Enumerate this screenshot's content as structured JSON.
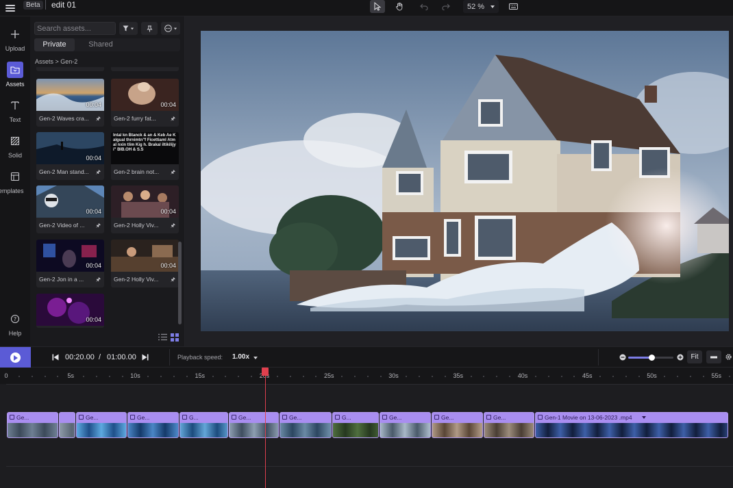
{
  "header": {
    "beta": "Beta",
    "title": "edit 01",
    "zoom": "52 %",
    "tools": [
      "pointer-icon",
      "hand-icon",
      "undo-icon",
      "redo-icon",
      "keyboard-icon"
    ]
  },
  "rail": {
    "items": [
      {
        "label": "Upload",
        "icon": "plus-icon"
      },
      {
        "label": "Assets",
        "icon": "folder-icon"
      },
      {
        "label": "Text",
        "icon": "text-icon"
      },
      {
        "label": "Solid",
        "icon": "solid-icon"
      },
      {
        "label": "Templates",
        "icon": "templates-icon"
      }
    ],
    "help": "Help"
  },
  "assets": {
    "search_placeholder": "Search assets...",
    "tabs": [
      "Private",
      "Shared"
    ],
    "breadcrumb": "Assets > Gen-2",
    "cards": [
      {
        "label": "Gen-2 Waves cra...",
        "duration": "00:04"
      },
      {
        "label": "Gen-2 furry fat...",
        "duration": "00:04"
      },
      {
        "label": "Gen-2 Man stand...",
        "duration": "00:04"
      },
      {
        "label": "Gen-2 brain not...",
        "duration": ""
      },
      {
        "label": "Gen-2 Video of ...",
        "duration": "00:04"
      },
      {
        "label": "Gen-2 Holly Viv...",
        "duration": "00:04"
      },
      {
        "label": "Gen-2 Jon in a ...",
        "duration": "00:04"
      },
      {
        "label": "Gen-2 Holly Viv...",
        "duration": "00:04"
      },
      {
        "label": "",
        "duration": "00:04"
      }
    ],
    "thumb_text": "Intal kn Btanck & an &  Keb Ae Kalgual thrnimtn\"f Ficettiaml Atmal nxin tlim Kig h. Brakal iltikilijy i\" BIB.OH & S.S"
  },
  "transport": {
    "current": "00:20.00",
    "sep": "/",
    "total": "01:00.00",
    "speed_label": "Playback speed:",
    "speed_value": "1.00x",
    "fit": "Fit"
  },
  "ruler": {
    "labels": [
      "0",
      "5s",
      "10s",
      "15s",
      "20s",
      "25s",
      "30s",
      "35s",
      "40s",
      "45s",
      "50s",
      "55s"
    ]
  },
  "timeline": {
    "clips": [
      {
        "label": "Ge..."
      },
      {
        "label": ""
      },
      {
        "label": "Ge..."
      },
      {
        "label": "Ge..."
      },
      {
        "label": "G..."
      },
      {
        "label": "Ge..."
      },
      {
        "label": "Ge..."
      },
      {
        "label": "G..."
      },
      {
        "label": "Ge..."
      },
      {
        "label": "Ge..."
      },
      {
        "label": "Ge..."
      },
      {
        "label": "Gen-1 Movie on 13-06-2023 .mp4"
      }
    ]
  },
  "colors": {
    "accent": "#5b5bd6",
    "clip": "#a98ef0",
    "playhead": "#e0404e"
  }
}
